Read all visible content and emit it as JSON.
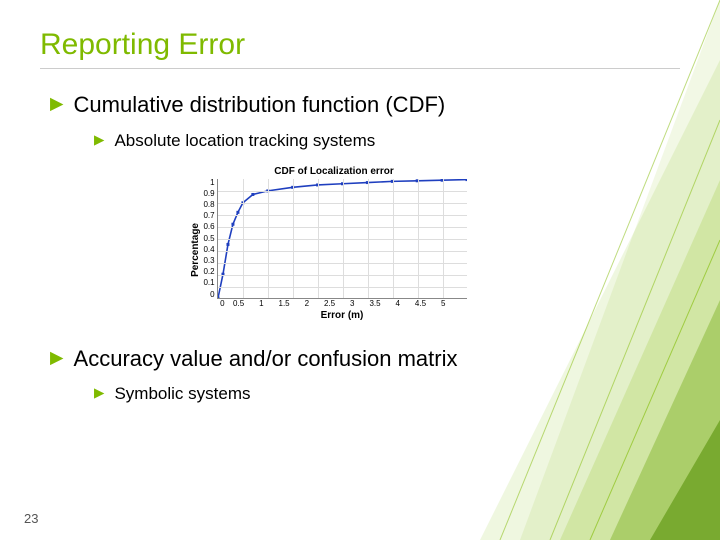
{
  "title": "Reporting Error",
  "bullets": {
    "b1": "Cumulative distribution function (CDF)",
    "b1_1": "Absolute location tracking systems",
    "b2": "Accuracy value and/or confusion matrix",
    "b2_1": "Symbolic systems"
  },
  "page_number": "23",
  "chart_data": {
    "type": "line",
    "title": "CDF of Localization error",
    "xlabel": "Error (m)",
    "ylabel": "Percentage",
    "xlim": [
      0,
      5
    ],
    "ylim": [
      0,
      1
    ],
    "xticks": [
      "0",
      "0.5",
      "1",
      "1.5",
      "2",
      "2.5",
      "3",
      "3.5",
      "4",
      "4.5",
      "5"
    ],
    "yticks": [
      "1",
      "0.9",
      "0.8",
      "0.7",
      "0.6",
      "0.5",
      "0.4",
      "0.3",
      "0.2",
      "0.1",
      "0"
    ],
    "series": [
      {
        "name": "CDF",
        "x": [
          0,
          0.1,
          0.2,
          0.3,
          0.4,
          0.5,
          0.7,
          1.0,
          1.5,
          2.0,
          2.5,
          3.0,
          3.5,
          4.0,
          4.5,
          5.0
        ],
        "values": [
          0,
          0.2,
          0.45,
          0.62,
          0.72,
          0.8,
          0.87,
          0.9,
          0.93,
          0.95,
          0.96,
          0.97,
          0.98,
          0.985,
          0.99,
          0.995
        ]
      }
    ]
  }
}
